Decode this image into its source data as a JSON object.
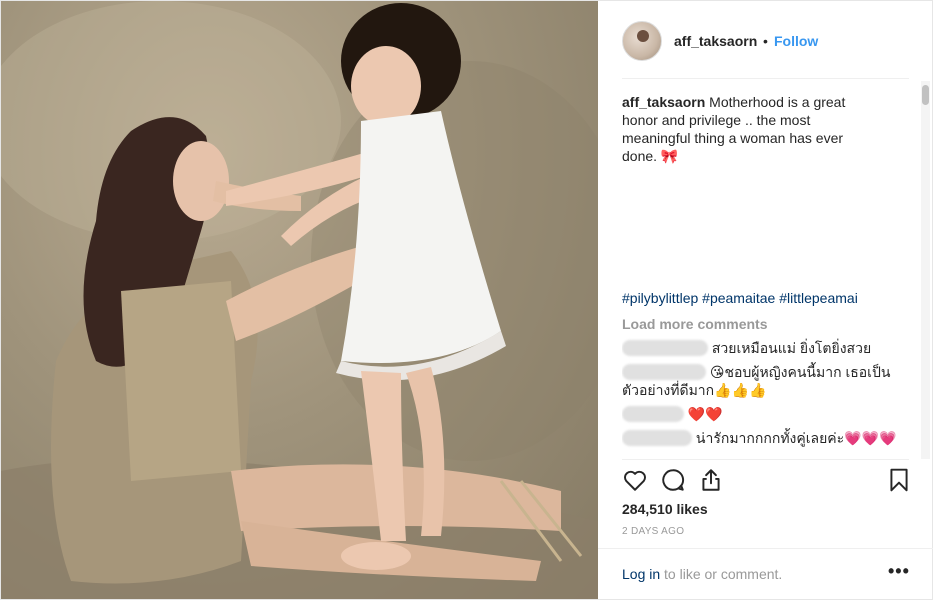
{
  "header": {
    "username": "aff_taksaorn",
    "separator": "•",
    "follow_label": "Follow"
  },
  "caption": {
    "username": "aff_taksaorn",
    "text": "Motherhood is a great honor and privilege .. the most meaningful thing a woman has ever done. 🎀"
  },
  "hashtags": "#pilybylittlep #peamaitae #littlepeamai",
  "load_more_label": "Load more comments",
  "comments": [
    {
      "text": "สวยเหมือนแม่ ยิ่งโตยิ่งสวย"
    },
    {
      "text": "😘ชอบผู้หญิงคนนี้มาก เธอเป็นตัวอย่างที่ดีมาก👍👍👍"
    },
    {
      "text": "❤️❤️"
    },
    {
      "text": "น่ารักมากกกกทั้งคู่เลยค่ะ💗💗💗"
    }
  ],
  "likes": "284,510 likes",
  "date": "2 DAYS AGO",
  "login": {
    "link": "Log in",
    "rest": " to like or comment."
  },
  "more_label": "•••",
  "icons": [
    "heart-icon",
    "comment-icon",
    "share-icon",
    "bookmark-icon",
    "more-options-icon"
  ],
  "colors": {
    "link": "#3897f0",
    "hashtag": "#003569",
    "muted": "#999999",
    "text": "#262626"
  }
}
